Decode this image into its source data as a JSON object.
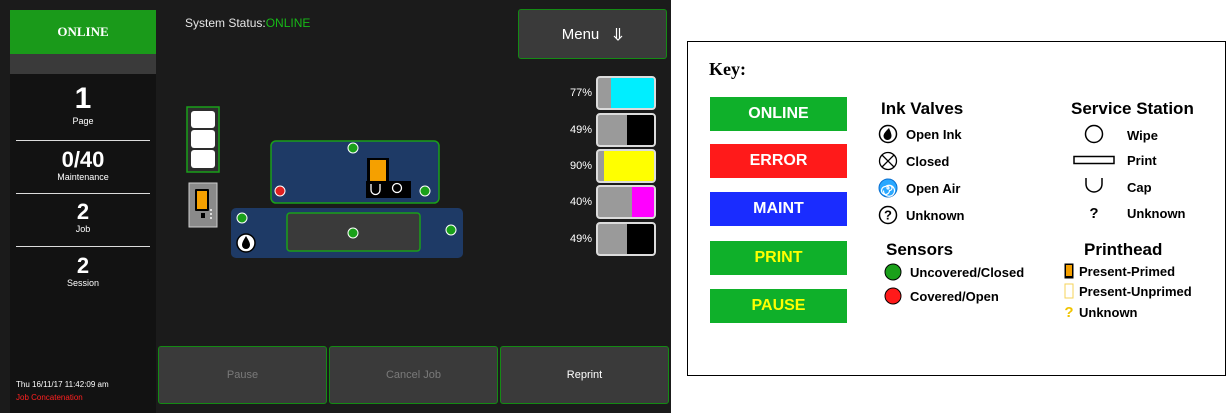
{
  "panel": {
    "status_label": "ONLINE",
    "system_status_label": "System Status:",
    "system_status_value": "ONLINE",
    "menu_label": "Menu",
    "menu_icon": "arrow-down-icon",
    "counters": [
      {
        "value": "1",
        "label": "Page"
      },
      {
        "value": "0/40",
        "label": "Maintenance"
      },
      {
        "value": "2",
        "label": "Job"
      },
      {
        "value": "2",
        "label": "Session"
      }
    ],
    "datetime": "Thu 16/11/17 11:42:09 am",
    "job_concatenation": "Job Concatenation",
    "ink_levels": [
      {
        "percent": "77%",
        "level": 0.77,
        "color": "#00eeff"
      },
      {
        "percent": "49%",
        "level": 0.49,
        "color": "#000000"
      },
      {
        "percent": "90%",
        "level": 0.9,
        "color": "#ffff00"
      },
      {
        "percent": "40%",
        "level": 0.4,
        "color": "#ff00ff"
      },
      {
        "percent": "49%",
        "level": 0.49,
        "color": "#000000"
      }
    ],
    "buttons": {
      "pause": "Pause",
      "cancel": "Cancel Job",
      "reprint": "Reprint"
    },
    "colors": {
      "online_green": "#1a9a1a",
      "sensor_green": "#1aa01a",
      "sensor_red": "#e02020",
      "printhead_orange": "#f5a000",
      "carriage_blue": "#1e3a66"
    }
  },
  "key": {
    "title": "Key:",
    "statuses": [
      {
        "label": "ONLINE",
        "bg": "#0fb02a",
        "fg": "#ffffff"
      },
      {
        "label": "ERROR",
        "bg": "#ff1a1a",
        "fg": "#ffffff"
      },
      {
        "label": "MAINT",
        "bg": "#1a2cff",
        "fg": "#ffffff"
      },
      {
        "label": "PRINT",
        "bg": "#0fb02a",
        "fg": "#ffff00"
      },
      {
        "label": "PAUSE",
        "bg": "#0fb02a",
        "fg": "#ffff00"
      }
    ],
    "ink_valves": {
      "heading": "Ink Valves",
      "items": [
        "Open Ink",
        "Closed",
        "Open Air",
        "Unknown"
      ]
    },
    "sensors": {
      "heading": "Sensors",
      "items": [
        "Uncovered/Closed",
        "Covered/Open"
      ]
    },
    "service_station": {
      "heading": "Service Station",
      "items": [
        "Wipe",
        "Print",
        "Cap",
        "Unknown"
      ],
      "unknown_symbol": "?"
    },
    "printhead": {
      "heading": "Printhead",
      "items": [
        "Present-Primed",
        "Present-Unprimed",
        "Unknown"
      ],
      "unknown_symbol": "?"
    }
  }
}
